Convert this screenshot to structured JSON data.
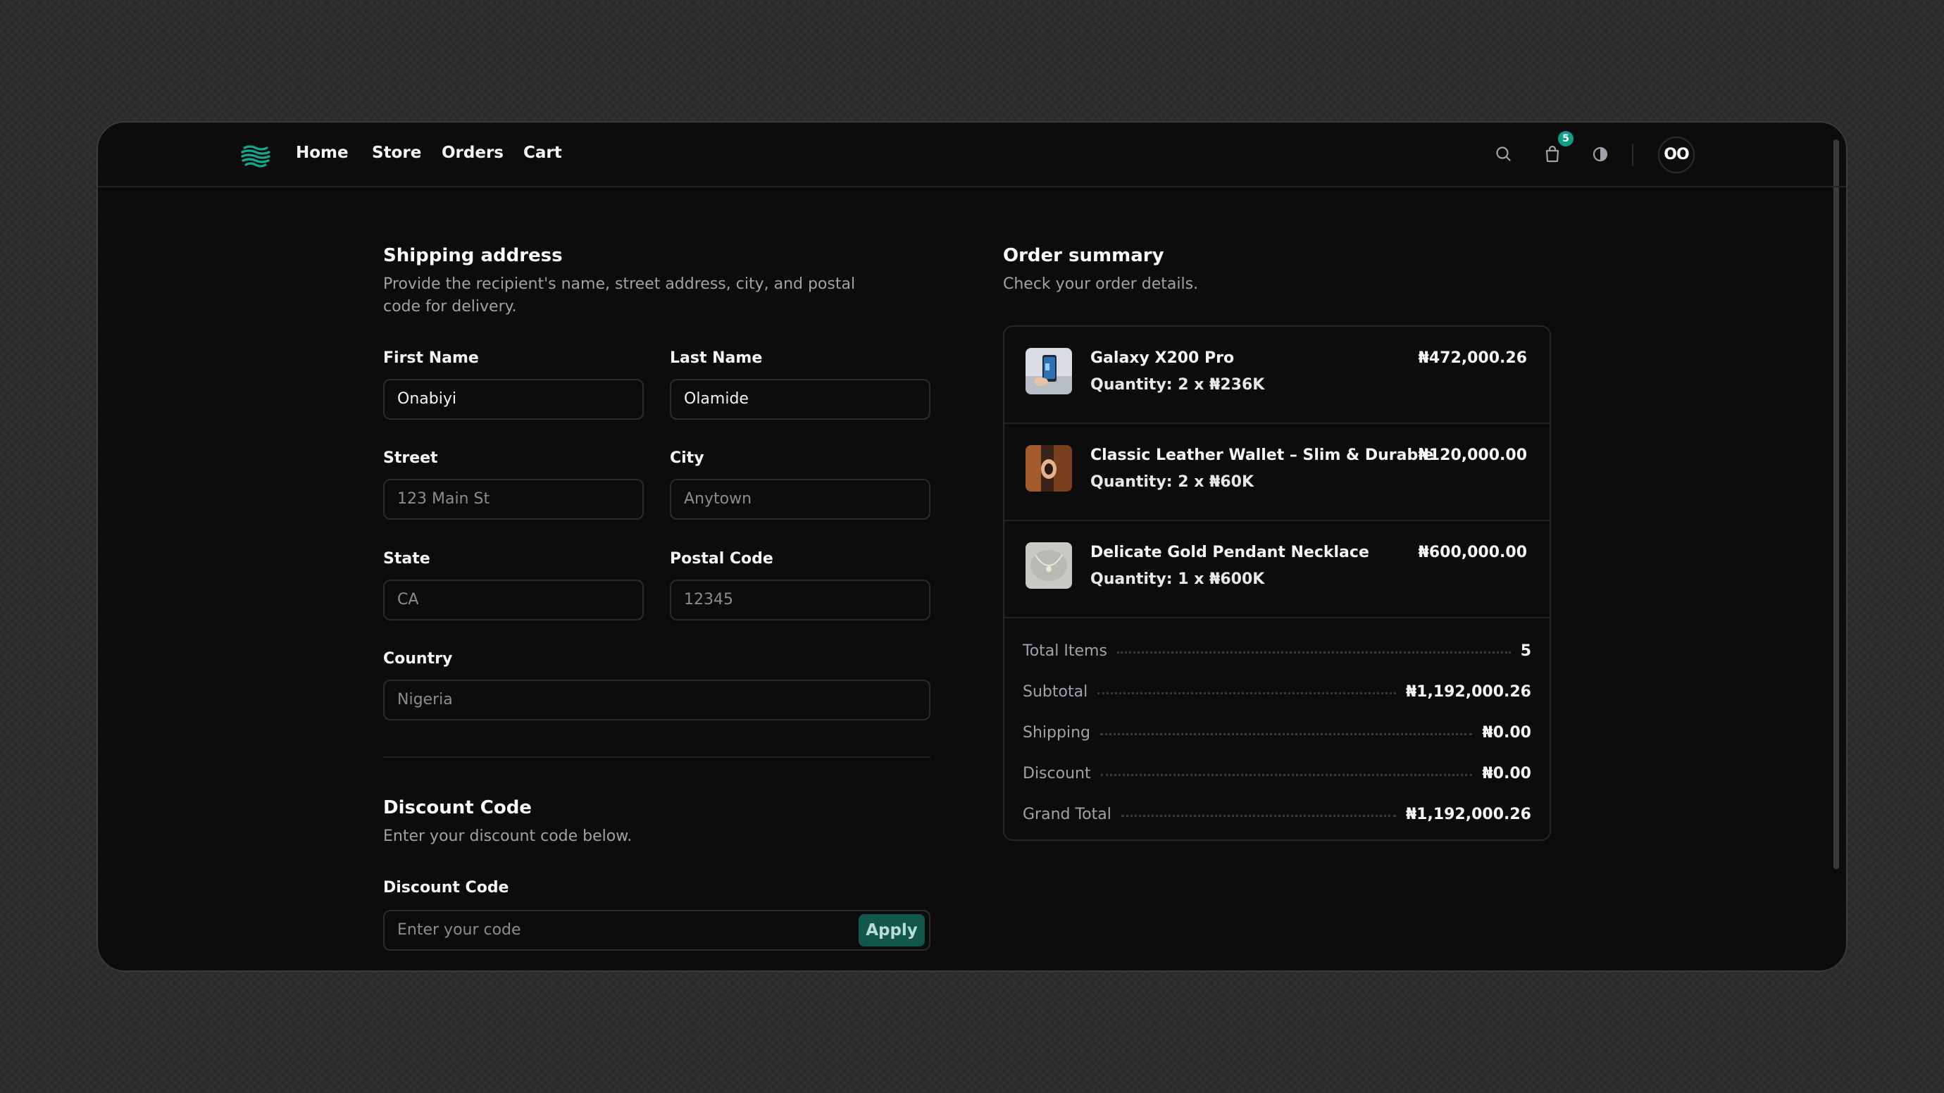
{
  "nav": {
    "links": [
      "Home",
      "Store",
      "Orders",
      "Cart"
    ],
    "cart_badge": "5",
    "avatar_initials": "OO"
  },
  "shipping": {
    "title": "Shipping address",
    "description": "Provide the recipient's name, street address, city, and postal code for delivery.",
    "first_name": {
      "label": "First Name",
      "value": "Onabiyi"
    },
    "last_name": {
      "label": "Last Name",
      "value": "Olamide"
    },
    "street": {
      "label": "Street",
      "placeholder": "123 Main St"
    },
    "city": {
      "label": "City",
      "placeholder": "Anytown"
    },
    "state": {
      "label": "State",
      "placeholder": "CA"
    },
    "postal_code": {
      "label": "Postal Code",
      "placeholder": "12345"
    },
    "country": {
      "label": "Country",
      "placeholder": "Nigeria"
    }
  },
  "discount": {
    "title": "Discount Code",
    "description": "Enter your discount code below.",
    "label": "Discount Code",
    "placeholder": "Enter your code",
    "apply_label": "Apply"
  },
  "summary": {
    "title": "Order summary",
    "description": "Check your order details.",
    "items": [
      {
        "name": "Galaxy X200 Pro",
        "quantity": "Quantity: 2 x ₦236K",
        "price": "₦472,000.26",
        "thumb": "phone-image"
      },
      {
        "name": "Classic Leather Wallet – Slim & Durable",
        "quantity": "Quantity: 2 x ₦60K",
        "price": "₦120,000.00",
        "thumb": "wallet-image"
      },
      {
        "name": "Delicate Gold Pendant Necklace",
        "quantity": "Quantity: 1 x ₦600K",
        "price": "₦600,000.00",
        "thumb": "necklace-image"
      }
    ],
    "totals": [
      {
        "label": "Total Items",
        "value": "5"
      },
      {
        "label": "Subtotal",
        "value": "₦1,192,000.26"
      },
      {
        "label": "Shipping",
        "value": "₦0.00"
      },
      {
        "label": "Discount",
        "value": "₦0.00"
      },
      {
        "label": "Grand Total",
        "value": "₦1,192,000.26"
      }
    ]
  },
  "colors": {
    "accent": "#0f9d86",
    "background": "#0c0c0d",
    "muted_text": "#a1a1aa"
  }
}
